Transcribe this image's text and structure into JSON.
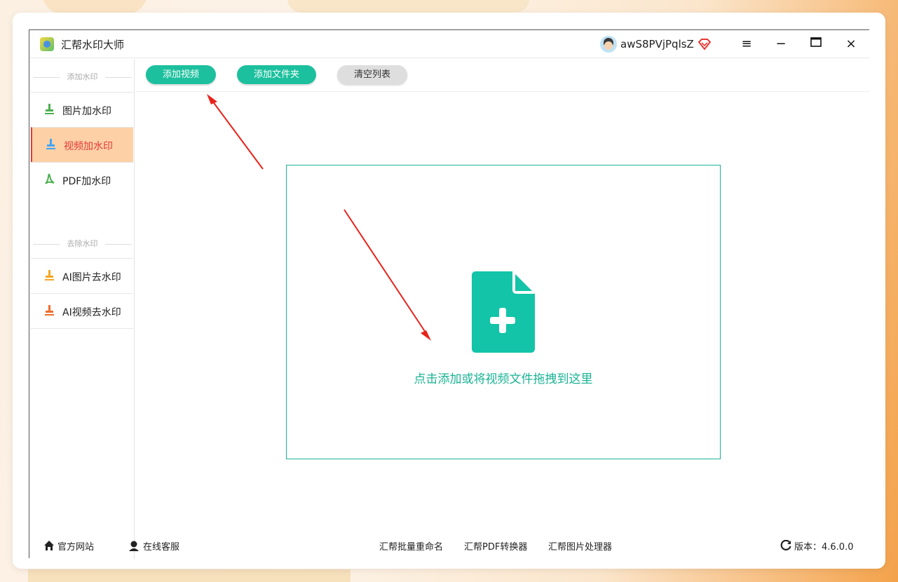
{
  "app": {
    "title": "汇帮水印大师"
  },
  "user": {
    "name": "awS8PVjPqlsZ"
  },
  "window_controls": {
    "menu": "≡",
    "minimize": "−",
    "maximize": "▭",
    "close": "×"
  },
  "sidebar": {
    "section_add": "添加水印",
    "section_remove": "去除水印",
    "items": [
      {
        "label": "图片加水印",
        "icon": "image-watermark-icon",
        "color": "#4caf50"
      },
      {
        "label": "视频加水印",
        "icon": "video-watermark-icon",
        "color": "#42a5f5",
        "active": true
      },
      {
        "label": "PDF加水印",
        "icon": "pdf-icon",
        "color": "#4caf50"
      },
      {
        "label": "AI图片去水印",
        "icon": "ai-image-remove-icon",
        "color": "#f5a623"
      },
      {
        "label": "AI视频去水印",
        "icon": "ai-video-remove-icon",
        "color": "#f06c2d"
      }
    ]
  },
  "toolbar": {
    "add_video": "添加视频",
    "add_folder": "添加文件夹",
    "clear_list": "清空列表"
  },
  "dropzone": {
    "text": "点击添加或将视频文件拖拽到这里"
  },
  "footer": {
    "website": "官方网站",
    "support": "在线客服",
    "batch_rename": "汇帮批量重命名",
    "pdf_converter": "汇帮PDF转换器",
    "image_processor": "汇帮图片处理器",
    "version": "版本：4.6.0.0"
  },
  "colors": {
    "accent": "#1cc09e",
    "active_bg": "#fdd0a6",
    "active_text": "#e53935",
    "arrow": "#e8231c"
  }
}
